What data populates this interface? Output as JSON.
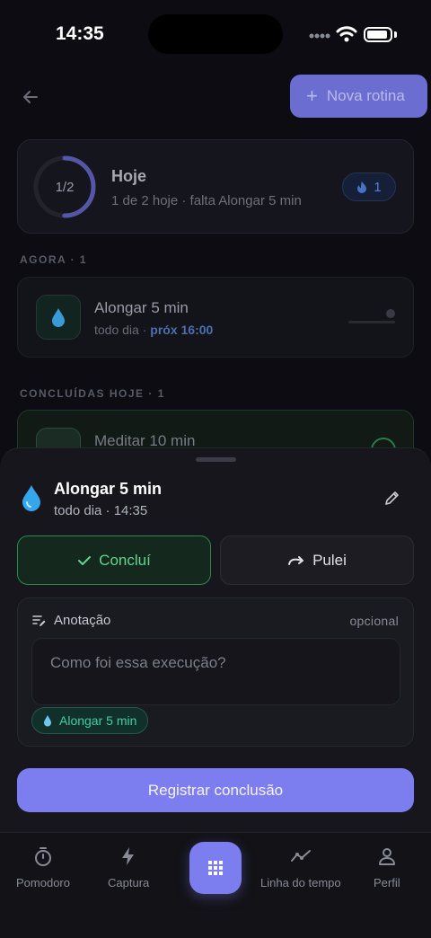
{
  "status_bar": {
    "time": "14:35"
  },
  "header": {
    "new_routine_label": "Nova rotina"
  },
  "today": {
    "progress_label": "1/2",
    "progress_fraction": 0.5,
    "title": "Hoje",
    "subtitle": "1 de 2 hoje · falta Alongar 5 min",
    "streak_count": "1"
  },
  "sections": {
    "now_label": "AGORA",
    "now_count": "· 1",
    "done_label": "CONCLUÍDAS HOJE",
    "done_count": "· 1"
  },
  "routine_now": {
    "title": "Alongar 5 min",
    "frequency": "todo dia · ",
    "next": "próx 16:00"
  },
  "routine_done": {
    "title": "Meditar 10 min"
  },
  "sheet": {
    "title": "Alongar 5 min",
    "subtitle": "todo dia · 14:35",
    "done_button": "Concluí",
    "skip_button": "Pulei",
    "note_label": "Anotação",
    "note_optional": "opcional",
    "note_placeholder": "Como foi essa execução?",
    "note_value": "",
    "tag_label": "Alongar 5 min",
    "register_button": "Registrar conclusão"
  },
  "tabbar": {
    "items": [
      {
        "label": "Pomodoro",
        "icon": "stopwatch-icon"
      },
      {
        "label": "Captura",
        "icon": "bolt-icon"
      },
      {
        "label": "",
        "icon": "grid-icon"
      },
      {
        "label": "Linha do tempo",
        "icon": "timeline-icon"
      },
      {
        "label": "Perfil",
        "icon": "person-icon"
      }
    ]
  },
  "colors": {
    "accent": "#7c7ef0",
    "success": "#5fd68b",
    "teal": "#3fcfa0",
    "background": "#0c0c12"
  }
}
